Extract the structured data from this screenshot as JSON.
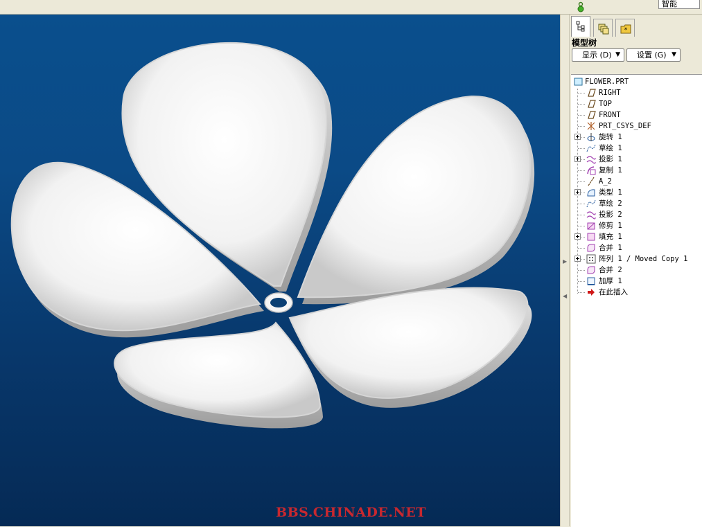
{
  "statusbar": {
    "mode": "智能"
  },
  "model_tree": {
    "title": "模型树",
    "buttons": {
      "show": "显示 (D)",
      "settings": "设置 (G)"
    },
    "root": "FLOWER.PRT",
    "items": [
      {
        "label": "RIGHT",
        "icon": "datum-plane-icon",
        "expandable": false
      },
      {
        "label": "TOP",
        "icon": "datum-plane-icon",
        "expandable": false
      },
      {
        "label": "FRONT",
        "icon": "datum-plane-icon",
        "expandable": false
      },
      {
        "label": "PRT_CSYS_DEF",
        "icon": "coordinate-system-icon",
        "expandable": false
      },
      {
        "label": "旋转 1",
        "icon": "revolve-icon",
        "expandable": true
      },
      {
        "label": "草绘 1",
        "icon": "sketch-icon",
        "expandable": false
      },
      {
        "label": "投影 1",
        "icon": "projection-icon",
        "expandable": true
      },
      {
        "label": "复制 1",
        "icon": "copy-icon",
        "expandable": false
      },
      {
        "label": "A_2",
        "icon": "datum-axis-icon",
        "expandable": false
      },
      {
        "label": "类型 1",
        "icon": "style-icon",
        "expandable": true
      },
      {
        "label": "草绘 2",
        "icon": "sketch-icon",
        "expandable": false
      },
      {
        "label": "投影 2",
        "icon": "projection-icon",
        "expandable": false
      },
      {
        "label": "修剪 1",
        "icon": "trim-icon",
        "expandable": false
      },
      {
        "label": "填充 1",
        "icon": "fill-icon",
        "expandable": true
      },
      {
        "label": "合并 1",
        "icon": "merge-icon",
        "expandable": false
      },
      {
        "label": "阵列 1 / Moved Copy 1",
        "icon": "pattern-icon",
        "expandable": true
      },
      {
        "label": "合并 2",
        "icon": "merge-icon",
        "expandable": false
      },
      {
        "label": "加厚 1",
        "icon": "thicken-icon",
        "expandable": false
      },
      {
        "label": "在此插入",
        "icon": "insert-here-arrow-icon",
        "expandable": false
      }
    ]
  },
  "watermark": "BBS.CHINADE.NET",
  "colors": {
    "viewport_top": "#0a4f8d",
    "viewport_bottom": "#052a55",
    "watermark": "#c8282f"
  }
}
